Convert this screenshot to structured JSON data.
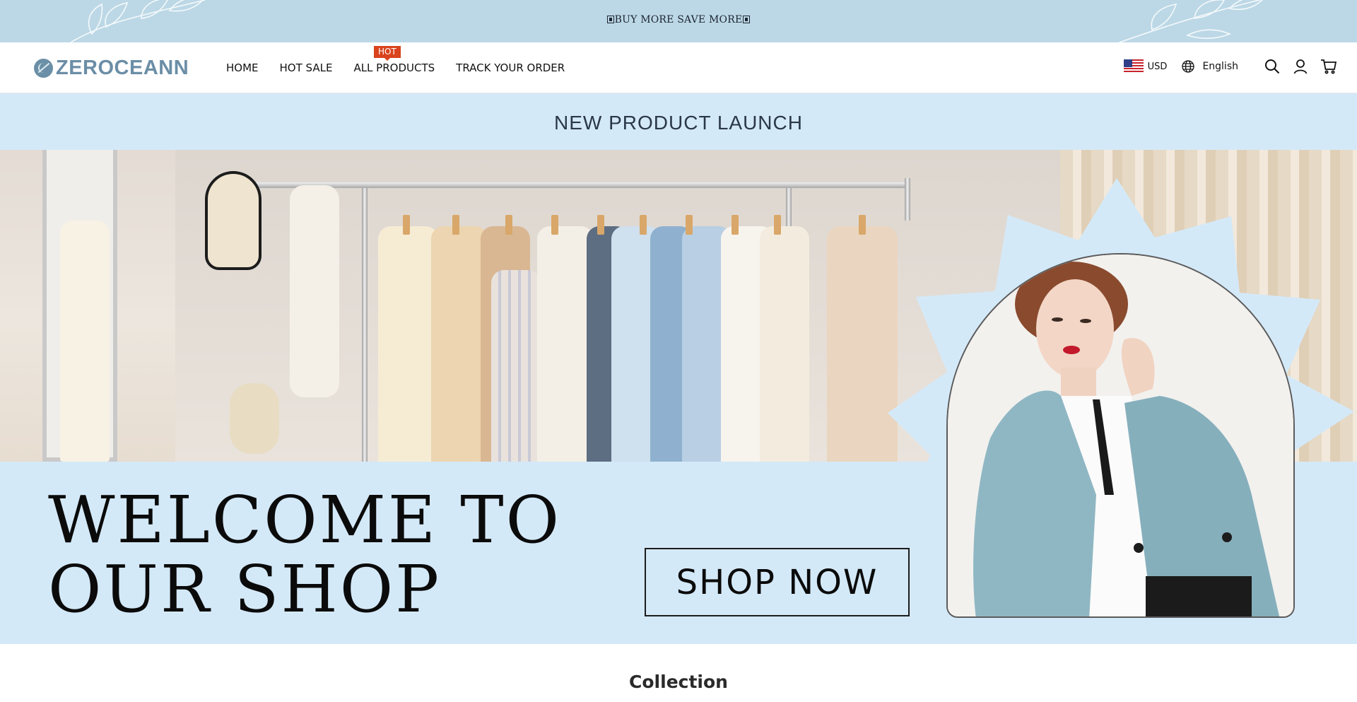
{
  "announcement": {
    "text": "BUY MORE SAVE MORE"
  },
  "header": {
    "logo_text": "ZEROCEANN",
    "nav": [
      {
        "label": "HOME"
      },
      {
        "label": "HOT SALE"
      },
      {
        "label": "ALL PRODUCTS",
        "badge": "HOT"
      },
      {
        "label": "TRACK YOUR ORDER"
      }
    ],
    "currency": "USD",
    "language": "English",
    "icons": [
      "globe-icon",
      "search-icon",
      "account-icon",
      "cart-icon"
    ]
  },
  "hero": {
    "subtitle": "NEW PRODUCT LAUNCH",
    "headline_line1": "WELCOME TO",
    "headline_line2": "OUR SHOP",
    "cta": "SHOP NOW",
    "colors": {
      "background": "#d4e9f8",
      "coat": "#8fb7c3",
      "accent_badge": "#d9431e"
    }
  },
  "collection_title": "Collection"
}
